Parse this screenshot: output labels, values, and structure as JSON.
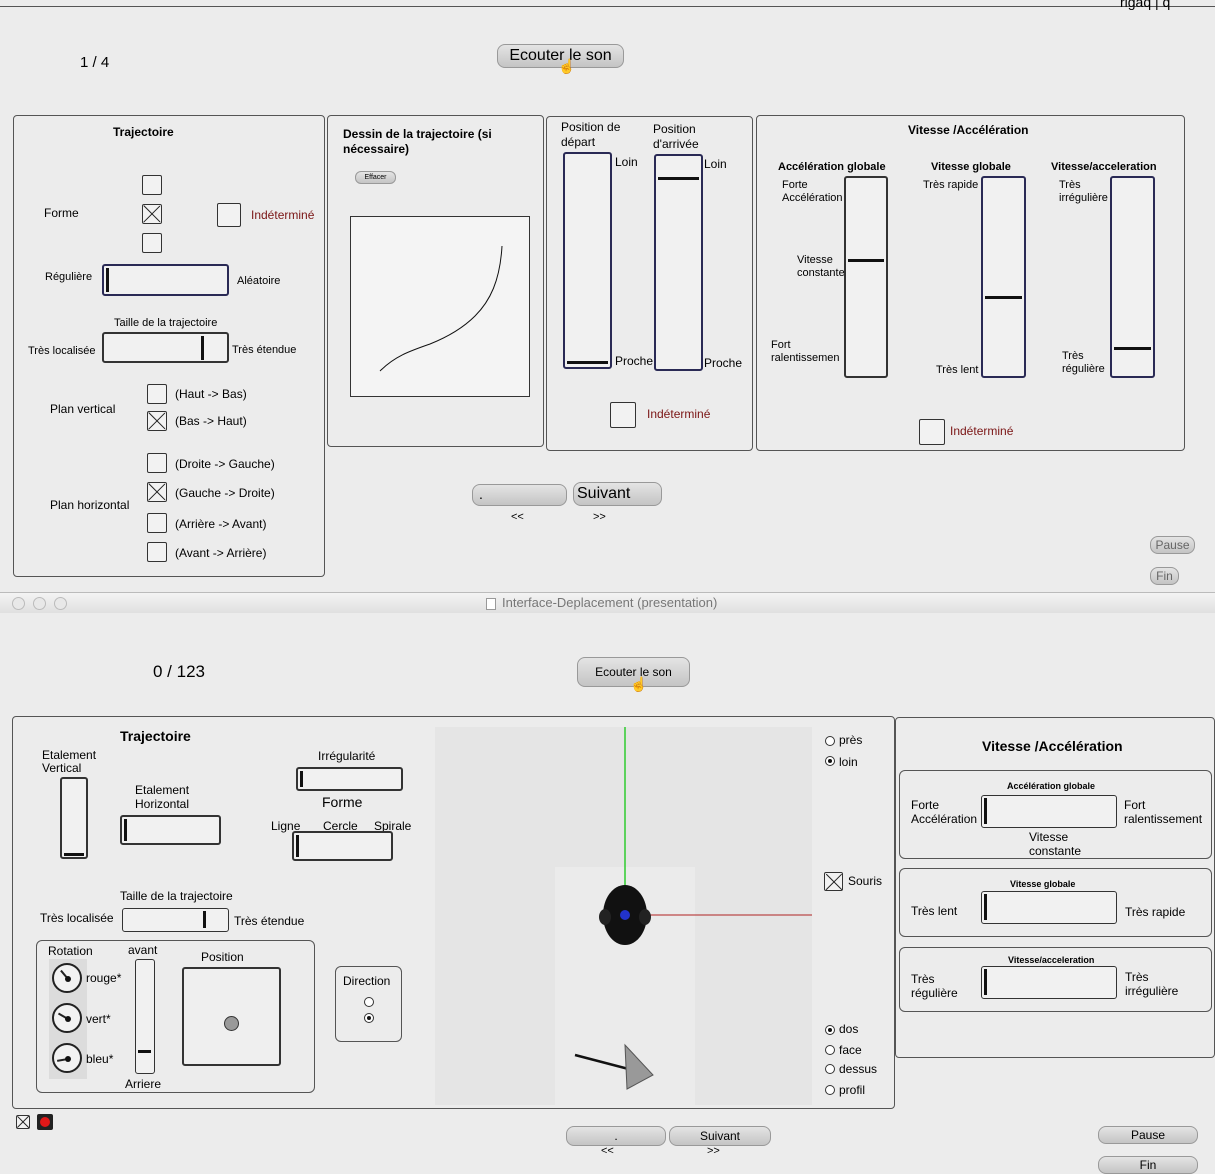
{
  "top": {
    "counter": "1 / 4",
    "listen_button": "Ecouter le son",
    "trajectoire": {
      "title": "Trajectoire",
      "forme_label": "Forme",
      "indetermine": "Indéterminé",
      "reguliere": "Régulière",
      "aleatoire": "Aléatoire",
      "taille_title": "Taille de la trajectoire",
      "tres_localisee": "Très localisée",
      "tres_etendue": "Très étendue",
      "plan_vertical": "Plan vertical",
      "haut_bas": "(Haut -> Bas)",
      "bas_haut": "(Bas -> Haut)",
      "plan_horizontal": "Plan horizontal",
      "droite_gauche": "(Droite -> Gauche)",
      "gauche_droite": "(Gauche -> Droite)",
      "arriere_avant": "(Arrière -> Avant)",
      "avant_arriere": "(Avant -> Arrière)"
    },
    "dessin": {
      "title_line1": "Dessin de la trajectoire (si",
      "title_line2": "nécessaire)",
      "effacer": "Effacer"
    },
    "position": {
      "depart_line1": "Position de",
      "depart_line2": "départ",
      "arrivee_line1": "Position",
      "arrivee_line2": "d'arrivée",
      "loin": "Loin",
      "proche": "Proche",
      "indetermine": "Indéterminé"
    },
    "vitesse": {
      "title": "Vitesse /Accélération",
      "acc_globale": "Accélération globale",
      "vit_globale": "Vitesse globale",
      "vit_acc": "Vitesse/acceleration",
      "forte_line1": "Forte",
      "forte_line2": "Accélération",
      "vit_const_line1": "Vitesse",
      "vit_const_line2": "constante",
      "fort_ral_line1": "Fort",
      "fort_ral_line2": "ralentissemen",
      "tres_rapide": "Très rapide",
      "tres_lent": "Très lent",
      "tres_irr_line1": "Très",
      "tres_irr_line2": "irrégulière",
      "tres_reg_line1": "Très",
      "tres_reg_line2": "régulière",
      "indetermine": "Indéterminé"
    },
    "nav": {
      "prev": ".",
      "next": "Suivant",
      "prev_arrows": "<<",
      "next_arrows": ">>"
    },
    "pause": "Pause",
    "fin": "Fin"
  },
  "window_title": "Interface-Deplacement (presentation)",
  "bottom": {
    "counter": "0 / 123",
    "listen_button": "Ecouter le son",
    "trajectoire": {
      "title": "Trajectoire",
      "etalement_vertical_line1": "Etalement",
      "etalement_vertical_line2": "Vertical",
      "etalement_horizontal_line1": "Etalement",
      "etalement_horizontal_line2": "Horizontal",
      "irregularite": "Irrégularité",
      "forme": "Forme",
      "ligne": "Ligne",
      "cercle": "Cercle",
      "spirale": "Spirale",
      "taille_title": "Taille de la trajectoire",
      "tres_localisee": "Très localisée",
      "tres_etendue": "Très étendue",
      "rotation": "Rotation",
      "avant": "avant",
      "arriere": "Arriere",
      "rouge": "rouge*",
      "vert": "vert*",
      "bleu": "bleu*",
      "position": "Position",
      "direction": "Direction"
    },
    "view": {
      "pres": "près",
      "loin": "loin",
      "souris": "Souris",
      "dos": "dos",
      "face": "face",
      "dessus": "dessus",
      "profil": "profil"
    },
    "vitesse": {
      "title": "Vitesse /Accélération",
      "acc_globale": "Accélération globale",
      "forte_line1": "Forte",
      "forte_line2": "Accélération",
      "fort_line1": "Fort",
      "fort_line2": "ralentissement",
      "vit_const_line1": "Vitesse",
      "vit_const_line2": "constante",
      "vit_globale": "Vitesse globale",
      "tres_lent": "Très lent",
      "tres_rapide": "Très rapide",
      "vit_acc": "Vitesse/acceleration",
      "tres_reg_line1": "Très",
      "tres_reg_line2": "régulière",
      "tres_irr_line1": "Très",
      "tres_irr_line2": "irrégulière"
    },
    "nav": {
      "prev": ".",
      "next": "Suivant",
      "prev_arrows": "<<",
      "next_arrows": ">>"
    },
    "pause": "Pause",
    "fin": "Fin"
  },
  "top_right_fragment": "rigaq | q"
}
